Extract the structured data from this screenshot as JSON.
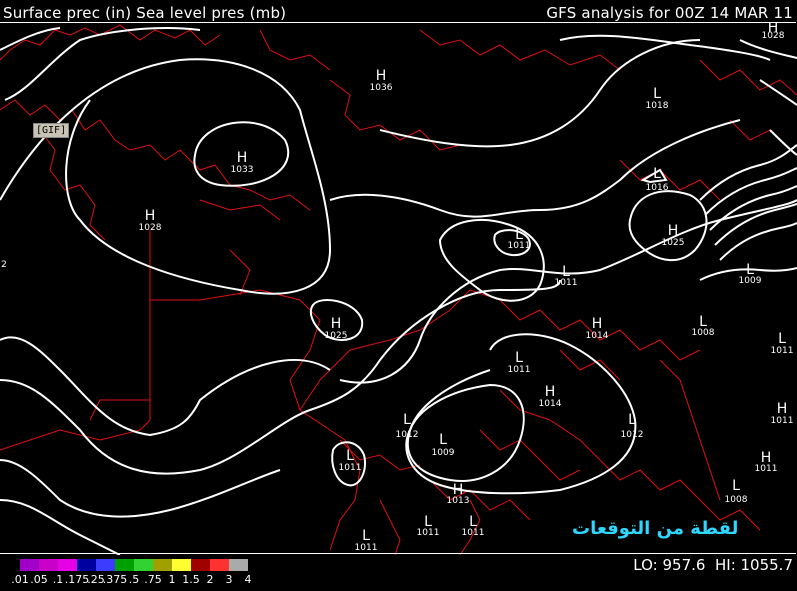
{
  "header": {
    "left": "Surface prec (in) Sea level pres (mb)",
    "right": "GFS analysis for 00Z 14 MAR 11"
  },
  "gif_button": "[GIF]",
  "watermark": "لقطة من التوقعات",
  "footer": {
    "lo": "LO: 957.6",
    "hi": "HI: 1055.7"
  },
  "legend": {
    "colors": [
      "#a000c8",
      "#c800c8",
      "#e600e6",
      "#0000a0",
      "#3c3cff",
      "#00a000",
      "#32d232",
      "#a0a000",
      "#ffff32",
      "#a00000",
      "#ff3232",
      "#aaaaaa"
    ],
    "labels": [
      ".01",
      ".05",
      ".1",
      ".175",
      ".25",
      ".375",
      ".5",
      ".75",
      "1",
      "1.5",
      "2",
      "3",
      "4"
    ]
  },
  "map_edge_label": "2",
  "pressure_centers": [
    {
      "type": "H",
      "value": "1036"
    },
    {
      "type": "H",
      "value": "1033"
    },
    {
      "type": "H",
      "value": "1028"
    },
    {
      "type": "H",
      "value": "1025"
    },
    {
      "type": "L",
      "value": "1011"
    },
    {
      "type": "L",
      "value": "1011"
    },
    {
      "type": "H",
      "value": "1014"
    },
    {
      "type": "L",
      "value": "1011"
    },
    {
      "type": "H",
      "value": "1014"
    },
    {
      "type": "L",
      "value": "1012"
    },
    {
      "type": "L",
      "value": "1009"
    },
    {
      "type": "L",
      "value": "1011"
    },
    {
      "type": "H",
      "value": "1013"
    },
    {
      "type": "L",
      "value": "1011"
    },
    {
      "type": "L",
      "value": "1011"
    },
    {
      "type": "L",
      "value": "1011"
    },
    {
      "type": "L",
      "value": "1012"
    },
    {
      "type": "L",
      "value": "1018"
    },
    {
      "type": "L",
      "value": "1016"
    },
    {
      "type": "H",
      "value": "1025"
    },
    {
      "type": "L",
      "value": "1009"
    },
    {
      "type": "L",
      "value": "1008"
    },
    {
      "type": "H",
      "value": "1028"
    },
    {
      "type": "L",
      "value": "1011"
    },
    {
      "type": "H",
      "value": "1011"
    },
    {
      "type": "H",
      "value": "1011"
    },
    {
      "type": "L",
      "value": "1008"
    }
  ]
}
